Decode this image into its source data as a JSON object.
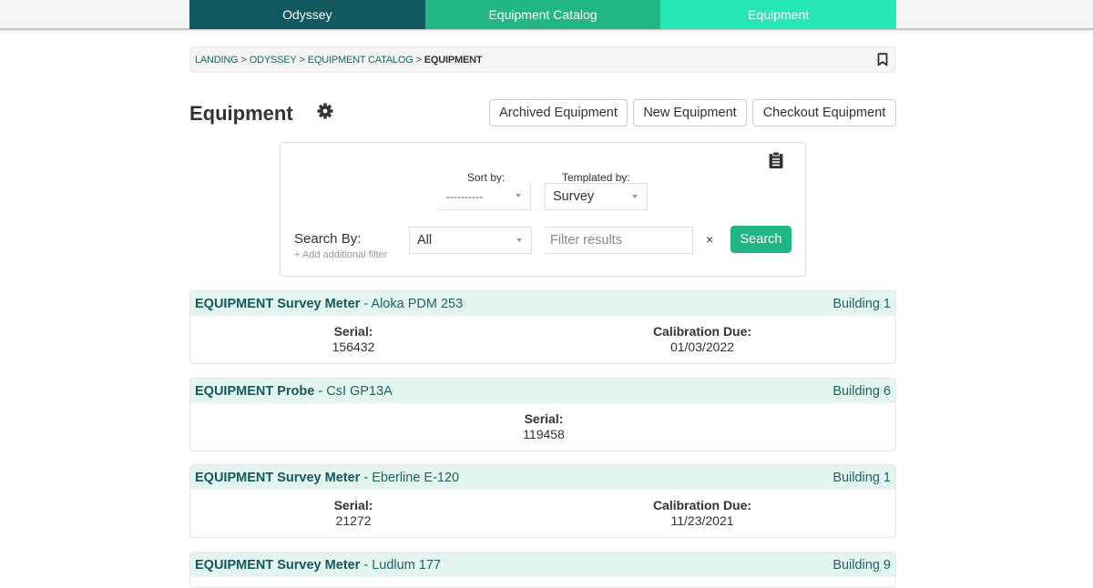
{
  "nav": {
    "items": [
      {
        "label": "Odyssey"
      },
      {
        "label": "Equipment Catalog"
      },
      {
        "label": "Equipment"
      }
    ]
  },
  "breadcrumb": {
    "items": [
      "LANDING",
      "ODYSSEY",
      "EQUIPMENT CATALOG"
    ],
    "separator": ">",
    "current": "EQUIPMENT"
  },
  "header": {
    "title": "Equipment",
    "buttons": {
      "archived": "Archived Equipment",
      "new": "New Equipment",
      "checkout": "Checkout Equipment"
    }
  },
  "filters": {
    "sort_label": "Sort by:",
    "sort_value": "----------",
    "templated_label": "Templated by:",
    "templated_value": "Survey",
    "search_by_label": "Search By:",
    "search_by_value": "All",
    "add_filter": "+ Add additional filter",
    "filter_placeholder": "Filter results",
    "filter_value": "",
    "clear": "×",
    "search_button": "Search"
  },
  "colors": {
    "nav_dark": "#11595e",
    "nav_mid": "#22b585",
    "nav_light": "#26e8b4",
    "card_header_bg": "#e4f5f0",
    "accent": "#22b585"
  },
  "results": [
    {
      "prefix": "EQUIPMENT",
      "type": "Survey Meter",
      "model": "Aloka PDM 253",
      "location": "Building 1",
      "serial_label": "Serial:",
      "serial": "156432",
      "cal_label": "Calibration Due:",
      "cal_due": "01/03/2022"
    },
    {
      "prefix": "EQUIPMENT",
      "type": "Probe",
      "model": "CsI GP13A",
      "location": "Building 6",
      "serial_label": "Serial:",
      "serial": "119458"
    },
    {
      "prefix": "EQUIPMENT",
      "type": "Survey Meter",
      "model": "Eberline E-120",
      "location": "Building 1",
      "serial_label": "Serial:",
      "serial": "21272",
      "cal_label": "Calibration Due:",
      "cal_due": "11/23/2021"
    },
    {
      "prefix": "EQUIPMENT",
      "type": "Survey Meter",
      "model": "Ludlum 177",
      "location": "Building 9"
    }
  ],
  "model_separator": " - "
}
